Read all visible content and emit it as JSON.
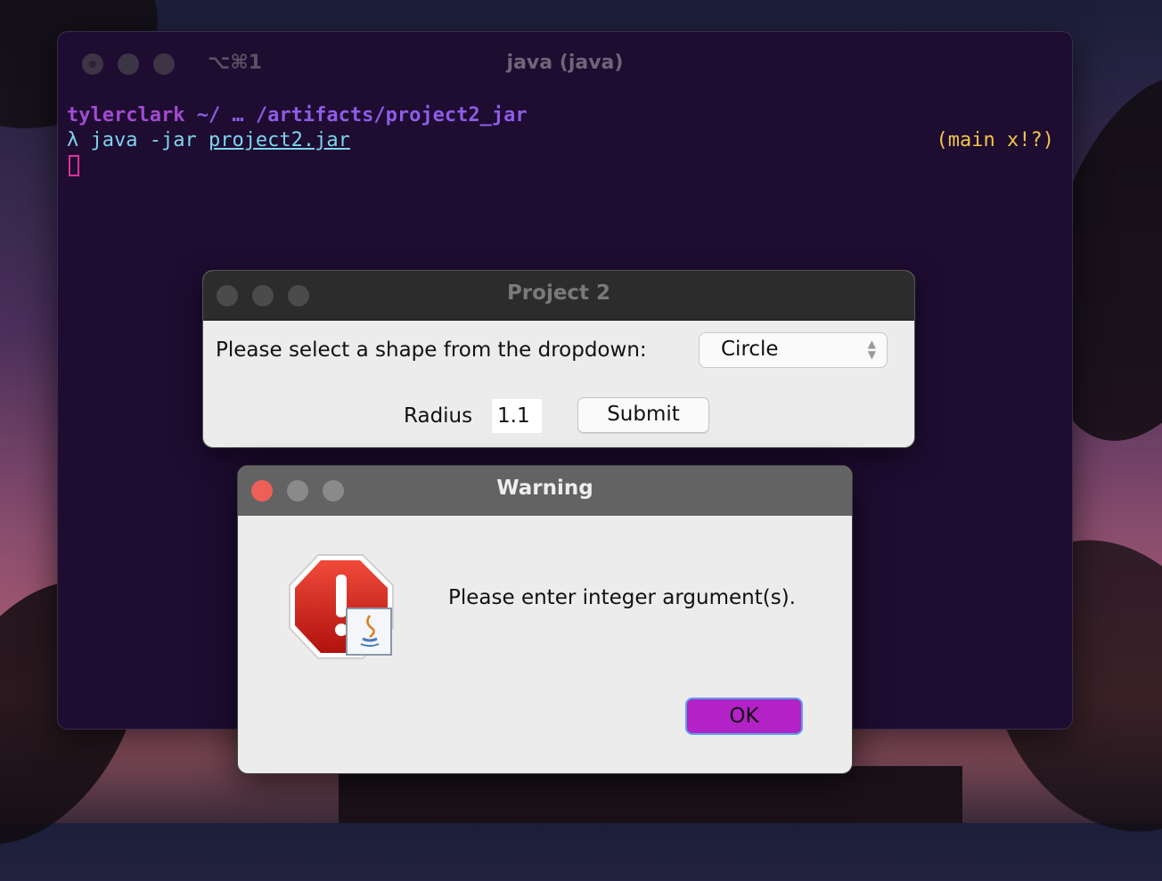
{
  "terminal": {
    "shortcut": "⌥⌘1",
    "title": "java (java)",
    "prompt_user": "tylerclark",
    "prompt_path": " ~/ … /artifacts/project2_jar",
    "cmd_prefix": "λ java -jar ",
    "cmd_file": "project2.jar",
    "git_status": "(main x!?)"
  },
  "project_window": {
    "title": "Project 2",
    "prompt_label": "Please select a shape from the dropdown:",
    "shape_selected": "Circle",
    "radius_label": "Radius",
    "radius_value": "1.1",
    "submit_label": "Submit"
  },
  "warning_dialog": {
    "title": "Warning",
    "message": "Please enter integer argument(s).",
    "ok_label": "OK",
    "icon": "warning-stop-java-icon"
  },
  "colors": {
    "terminal_bg": "#1e0c31",
    "ok_button": "#b322c6",
    "close_red": "#ee5f57"
  }
}
